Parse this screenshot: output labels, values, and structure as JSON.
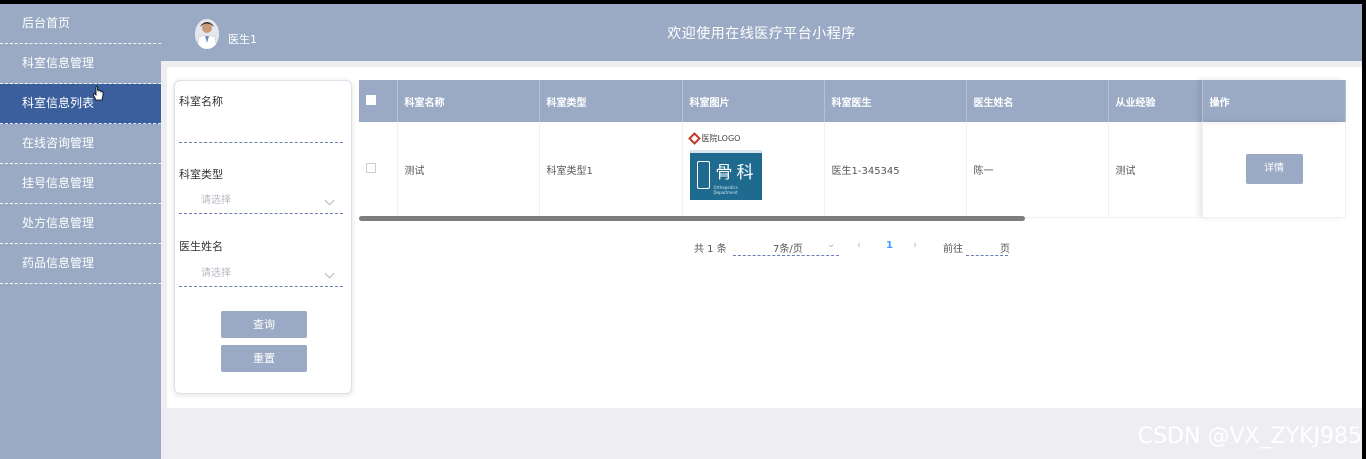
{
  "sidebar": {
    "items": [
      {
        "label": "后台首页"
      },
      {
        "label": "科室信息管理"
      },
      {
        "label": "科室信息列表"
      },
      {
        "label": "在线咨询管理"
      },
      {
        "label": "挂号信息管理"
      },
      {
        "label": "处方信息管理"
      },
      {
        "label": "药品信息管理"
      }
    ]
  },
  "header": {
    "user": "医生1",
    "title": "欢迎使用在线医疗平台小程序"
  },
  "search": {
    "dept_name_label": "科室名称",
    "dept_type_label": "科室类型",
    "dept_type_placeholder": "请选择",
    "doctor_name_label": "医生姓名",
    "doctor_name_placeholder": "请选择",
    "query_button": "查询",
    "reset_button": "重置"
  },
  "table": {
    "headers": [
      "科室名称",
      "科室类型",
      "科室图片",
      "科室医生",
      "医生姓名",
      "从业经验",
      "操作"
    ],
    "rows": [
      {
        "name": "测试",
        "type": "科室类型1",
        "image": {
          "logo_text": "医院LOGO",
          "board_text": "骨科",
          "board_sub": "Orthopedics Department"
        },
        "doctor": "医生1-345345",
        "doctor_name": "陈一",
        "experience": "测试",
        "action": "详情"
      }
    ]
  },
  "pagination": {
    "total": "共 1 条",
    "page_size": "7条/页",
    "current_page": "1",
    "goto_label": "前往",
    "page_suffix": "页"
  },
  "watermark": "CSDN @VX_ZYKJ985",
  "colors": {
    "sidebar_bg": "#9aaac4",
    "active_item": "#3a5f9c",
    "button": "#9aaac4",
    "dept_board": "#1e6b8f"
  }
}
